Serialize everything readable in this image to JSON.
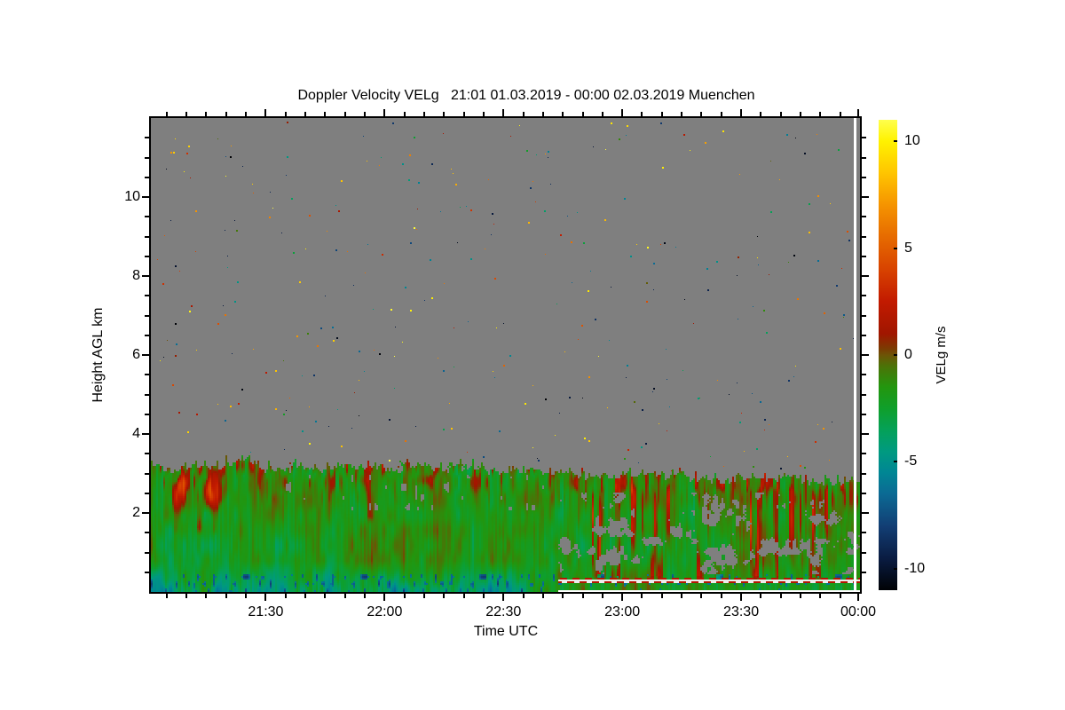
{
  "title": "Doppler Velocity VELg   21:01 01.03.2019 - 00:00 02.03.2019 Muenchen",
  "axes": {
    "x": {
      "label": "Time UTC",
      "major_ticks": [
        {
          "label": "21:30",
          "minute": 29
        },
        {
          "label": "22:00",
          "minute": 59
        },
        {
          "label": "22:30",
          "minute": 89
        },
        {
          "label": "23:00",
          "minute": 119
        },
        {
          "label": "23:30",
          "minute": 149
        },
        {
          "label": "00:00",
          "minute": 179
        }
      ],
      "minor_step_minute": 5,
      "span_minutes": 179
    },
    "y": {
      "label": "Height AGL km",
      "major_ticks": [
        {
          "label": "2",
          "km": 2
        },
        {
          "label": "4",
          "km": 4
        },
        {
          "label": "6",
          "km": 6
        },
        {
          "label": "8",
          "km": 8
        },
        {
          "label": "10",
          "km": 10
        }
      ],
      "minor_step_km": 0.5,
      "range_km": [
        0,
        12
      ]
    }
  },
  "colorbar": {
    "label": "VELg m/s",
    "range": [
      -11,
      11
    ],
    "ticks": [
      {
        "label": "10",
        "value": 10
      },
      {
        "label": "5",
        "value": 5
      },
      {
        "label": "0",
        "value": 0
      },
      {
        "label": "-5",
        "value": -5
      },
      {
        "label": "-10",
        "value": -10
      }
    ]
  },
  "chart_data": {
    "type": "heatmap",
    "title": "Doppler Velocity VELg 21:01 01.03.2019 - 00:00 02.03.2019 Muenchen",
    "site": "Muenchen",
    "xlabel": "Time UTC",
    "ylabel": "Height AGL km",
    "zlabel": "VELg m/s",
    "x_range_utc": [
      "21:01 01.03.2019",
      "00:00 02.03.2019"
    ],
    "x_span_minutes": 179,
    "y_range_km": [
      0,
      12
    ],
    "z_range_ms": [
      -11,
      11
    ],
    "no_signal_color": "#7f7f7f",
    "colormap_stops": [
      [
        -11,
        "#000205"
      ],
      [
        -9.5,
        "#0a1c42"
      ],
      [
        -8,
        "#123e74"
      ],
      [
        -6.5,
        "#0b6a94"
      ],
      [
        -5.5,
        "#008694"
      ],
      [
        -4.5,
        "#009a80"
      ],
      [
        -3.5,
        "#05a158"
      ],
      [
        -2.5,
        "#0f9f2b"
      ],
      [
        -1.5,
        "#23960e"
      ],
      [
        -0.5,
        "#4c7207"
      ],
      [
        0,
        "#6d5406"
      ],
      [
        0.3,
        "#7c3a02"
      ],
      [
        1,
        "#a01600"
      ],
      [
        2.5,
        "#c21a00"
      ],
      [
        4,
        "#d84300"
      ],
      [
        5.5,
        "#e66a00"
      ],
      [
        7,
        "#f59300"
      ],
      [
        8.5,
        "#ffc400"
      ],
      [
        10,
        "#fff200"
      ],
      [
        11,
        "#ffff4d"
      ]
    ],
    "cloud_top_profile": {
      "t_min": [
        0,
        12,
        21,
        24,
        27,
        40,
        60,
        80,
        95,
        105,
        115,
        130,
        145,
        160,
        170,
        179
      ],
      "top_km": [
        3.15,
        3.1,
        3.2,
        3.4,
        3.15,
        3.1,
        3.15,
        3.1,
        3.05,
        2.95,
        2.9,
        2.95,
        2.8,
        2.85,
        2.75,
        2.8
      ]
    },
    "mean_velocity_in_cloud_ms": -1.7,
    "noise_speckle_count": 330,
    "features": [
      {
        "name": "near-surface-downdraft-layer",
        "t_min": [
          0,
          103
        ],
        "h_km": [
          0,
          0.78
        ],
        "velocity_bias_ms": -2.6
      },
      {
        "name": "deep-downdraft-patches",
        "t_min": [
          0,
          100
        ],
        "h_km": [
          0,
          0.42
        ],
        "velocity_bias_ms": -6
      },
      {
        "name": "updraft-region-early",
        "t_min": [
          1,
          22
        ],
        "h_km": [
          1.4,
          3.2
        ],
        "velocity_bias_ms": 3.0
      },
      {
        "name": "cloud-top-bump-updraft",
        "t_min": [
          19,
          29
        ],
        "h_km": [
          2.5,
          3.45
        ],
        "velocity_bias_ms": 2.5
      },
      {
        "name": "mid-evening-updraft",
        "t_min": [
          48,
          82
        ],
        "h_km": [
          1.7,
          3.0
        ],
        "velocity_bias_ms": 2.2
      },
      {
        "name": "late-updraft-streaks",
        "t_min": [
          102,
          179
        ],
        "h_km": [
          0.2,
          2.75
        ],
        "velocity_bias_ms": 3.2
      },
      {
        "name": "signal-gaps",
        "t_min": [
          103,
          179
        ],
        "h_km": [
          0.45,
          2.5
        ],
        "type": "no-signal"
      },
      {
        "name": "clutter-dashed-line",
        "t_min": [
          103,
          179
        ],
        "h_km": [
          0.22,
          0.3
        ],
        "type": "dashed-red-line"
      }
    ]
  }
}
